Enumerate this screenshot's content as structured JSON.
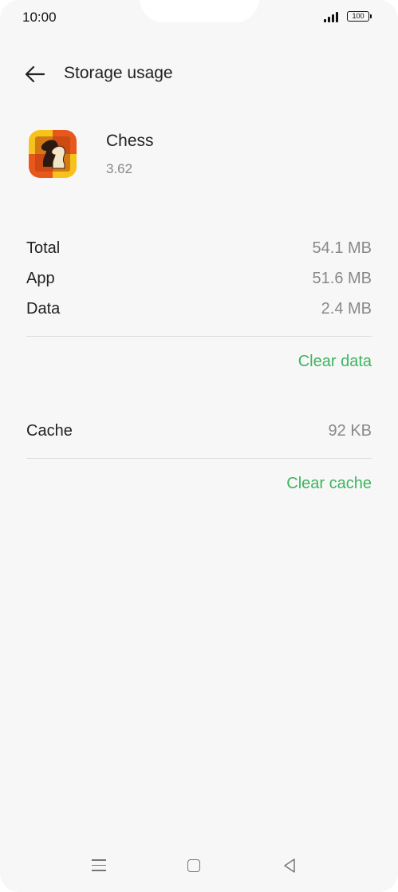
{
  "status_bar": {
    "time": "10:00",
    "battery": "100",
    "icons": [
      "signal-icon",
      "battery-icon"
    ]
  },
  "header": {
    "back_icon": "arrow-left-icon",
    "title": "Storage usage"
  },
  "app": {
    "icon": "chess-app-icon",
    "name": "Chess",
    "version": "3.62"
  },
  "storage": {
    "rows": [
      {
        "label": "Total",
        "value": "54.1 MB"
      },
      {
        "label": "App",
        "value": "51.6 MB"
      },
      {
        "label": "Data",
        "value": "2.4 MB"
      }
    ],
    "clear_data_label": "Clear data"
  },
  "cache": {
    "label": "Cache",
    "value": "92 KB",
    "clear_cache_label": "Clear cache"
  },
  "nav_bar": {
    "icons": [
      "menu-icon",
      "home-icon",
      "back-triangle-icon"
    ]
  },
  "colors": {
    "accent": "#3cb55e",
    "background": "#f7f7f7",
    "text_primary": "#222222",
    "text_secondary": "#888888"
  }
}
